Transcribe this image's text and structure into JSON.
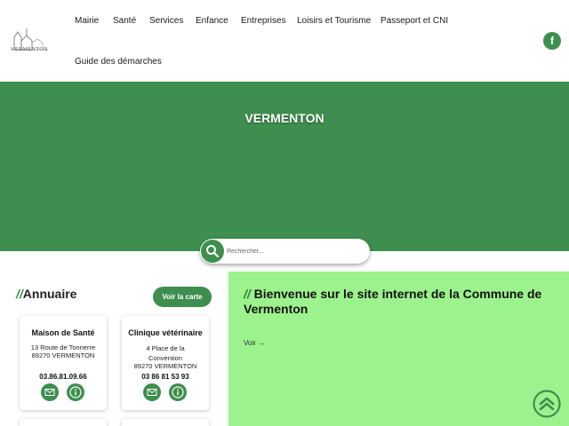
{
  "logo": {
    "text": "VERMENTON"
  },
  "nav": {
    "items": [
      {
        "label": "Mairie"
      },
      {
        "label": "Santé"
      },
      {
        "label": "Services"
      },
      {
        "label": "Enfance"
      },
      {
        "label": "Entreprises"
      },
      {
        "label": "Loisirs et Tourisme"
      },
      {
        "label": "Passeport et CNI"
      },
      {
        "label": "Guide des démarches"
      }
    ]
  },
  "social": {
    "facebook_label": "f"
  },
  "hero": {
    "title": "VERMENTON"
  },
  "search": {
    "placeholder": "Rechercher..."
  },
  "annuaire": {
    "prefix": "//",
    "title": "Annuaire",
    "map_button": "Voir la carte",
    "cards": [
      {
        "name": "Maison de Santé",
        "address": [
          "13 Route de Tonnerre",
          "89270 VERMENTON"
        ],
        "phone": "03.86.81.09.66"
      },
      {
        "name": "Clinique vétérinaire",
        "address": [
          "4 Place de la",
          "Convention",
          "89270 VERMENTON"
        ],
        "phone": "03 86 81 53 93"
      }
    ]
  },
  "welcome": {
    "prefix": "//",
    "title": "Bienvenue sur le site internet de la Commune de Vermenton",
    "link": "Voir →"
  },
  "colors": {
    "primary": "#3e8e4f",
    "welcome_bg": "#9cf28c"
  },
  "icons": {
    "search": "search-icon",
    "mail": "mail-icon",
    "info": "info-icon",
    "top": "chevron-up-icon",
    "facebook": "facebook-icon"
  }
}
